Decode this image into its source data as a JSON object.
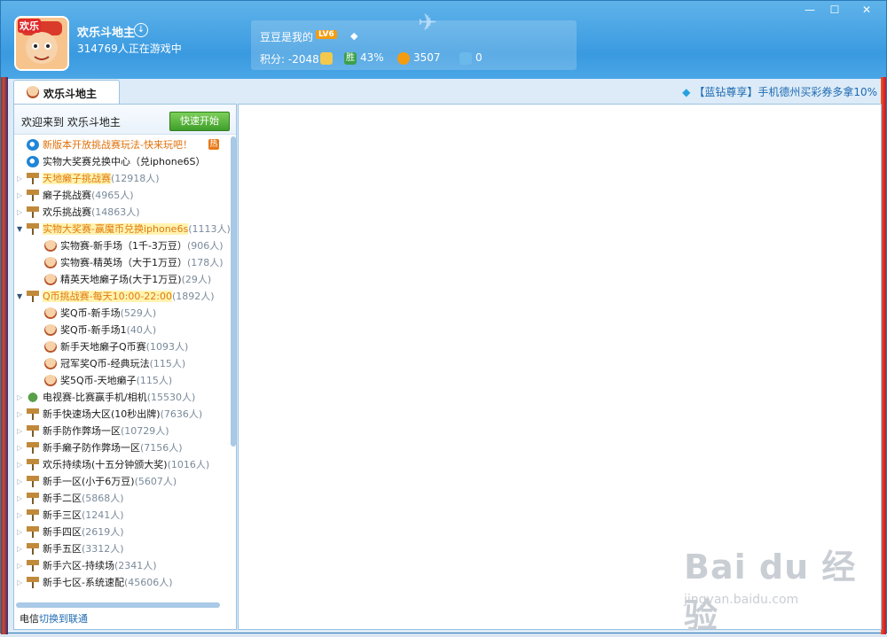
{
  "app": {
    "name": "欢乐斗地主",
    "online": "314769人正在游戏中",
    "avatar_tag": "欢乐"
  },
  "user": {
    "nick": "豆豆是我的",
    "level": "LV6",
    "score_label": "积分:",
    "score": "-2048",
    "win_label": "胜",
    "win_rate": "43%",
    "beans": "3507",
    "coupons": "0"
  },
  "tab": {
    "label": "欢乐斗地主"
  },
  "promo": "【蓝钻尊享】手机德州买彩券多拿10%",
  "left": {
    "welcome": "欢迎来到 欢乐斗地主",
    "quick_start": "快速开始",
    "hot": "热",
    "rows": [
      {
        "label": "新版本开放挑战赛玩法-快来玩吧！",
        "count": ""
      },
      {
        "label": "实物大奖赛兑换中心（兑iphone6S）",
        "count": ""
      },
      {
        "label": "天地癞子挑战赛",
        "count": "(12918人)"
      },
      {
        "label": "癞子挑战赛",
        "count": "(4965人)"
      },
      {
        "label": "欢乐挑战赛",
        "count": "(14863人)"
      },
      {
        "label": "实物大奖赛-赢魔币兑换iphone6s",
        "count": "(1113人)"
      },
      {
        "label": "实物赛-新手场（1千-3万豆）",
        "count": "(906人)"
      },
      {
        "label": "实物赛-精英场（大于1万豆）",
        "count": "(178人)"
      },
      {
        "label": "精英天地癞子场(大于1万豆)",
        "count": "(29人)"
      },
      {
        "label": "Q币挑战赛-每天10:00-22:00",
        "count": "(1892人)"
      },
      {
        "label": "奖Q币-新手场",
        "count": "(529人)"
      },
      {
        "label": "奖Q币-新手场1",
        "count": "(40人)"
      },
      {
        "label": "新手天地癞子Q币赛",
        "count": "(1093人)"
      },
      {
        "label": "冠军奖Q币-经典玩法",
        "count": "(115人)"
      },
      {
        "label": "奖5Q币-天地癞子",
        "count": "(115人)"
      },
      {
        "label": "电视赛-比赛赢手机/相机",
        "count": "(15530人)"
      },
      {
        "label": "新手快速场大区(10秒出牌)",
        "count": "(7636人)"
      },
      {
        "label": "新手防作弊场一区",
        "count": "(10729人)"
      },
      {
        "label": "新手癞子防作弊场一区",
        "count": "(7156人)"
      },
      {
        "label": "欢乐持续场(十五分钟颁大奖)",
        "count": "(1016人)"
      },
      {
        "label": "新手一区(小于6万豆)",
        "count": "(5607人)"
      },
      {
        "label": "新手二区",
        "count": "(5868人)"
      },
      {
        "label": "新手三区",
        "count": "(1241人)"
      },
      {
        "label": "新手四区",
        "count": "(2619人)"
      },
      {
        "label": "新手五区",
        "count": "(3312人)"
      },
      {
        "label": "新手六区-持续场",
        "count": "(2341人)"
      },
      {
        "label": "新手七区-系统速配",
        "count": "(45606人)"
      }
    ],
    "bottom_prefix": "电信",
    "bottom_link": "切换到联通"
  },
  "watermark": {
    "main": "Bai du 经验",
    "sub": "jingyan.baidu.com"
  }
}
